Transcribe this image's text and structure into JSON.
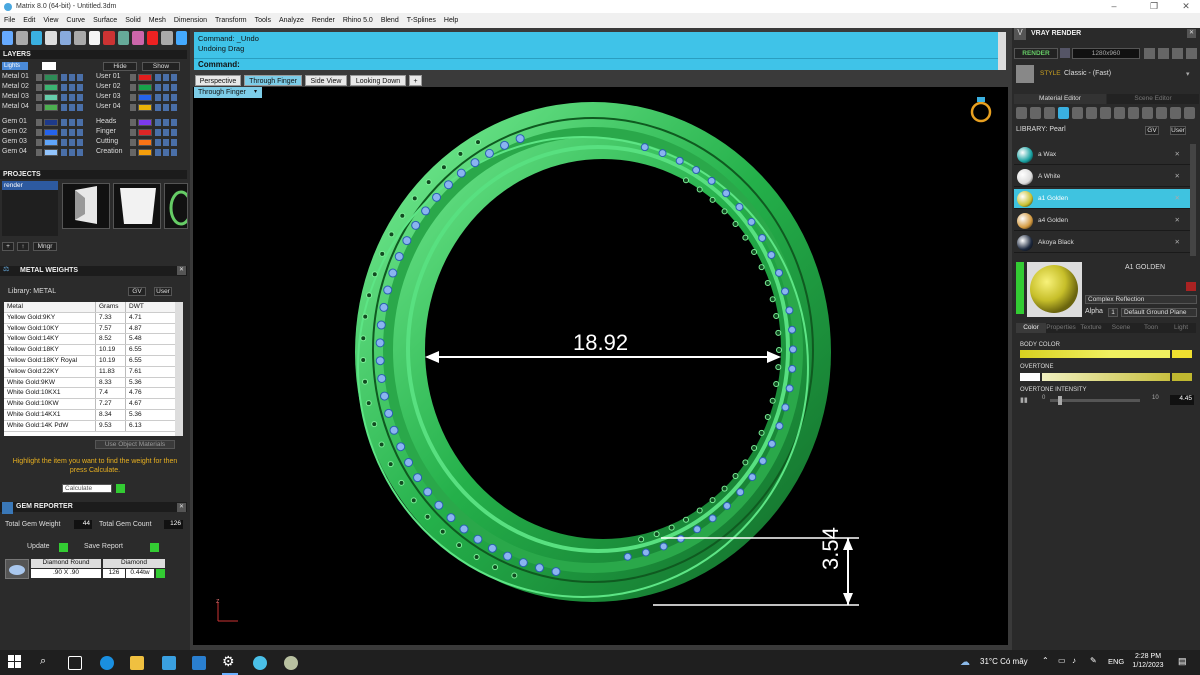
{
  "window": {
    "title": "Matrix 8.0 (64-bit) - Untitled.3dm"
  },
  "menu": [
    "File",
    "Edit",
    "View",
    "Curve",
    "Surface",
    "Solid",
    "Mesh",
    "Dimension",
    "Transform",
    "Tools",
    "Analyze",
    "Render",
    "Rhino 5.0",
    "Blend",
    "T-Splines",
    "Help"
  ],
  "layers": {
    "title": "LAYERS",
    "lights_label": "Lights",
    "hide_label": "Hide",
    "show_label": "Show",
    "left": [
      {
        "name": "Metal 01",
        "color": "#2e8b57"
      },
      {
        "name": "Metal 02",
        "color": "#3cb371"
      },
      {
        "name": "Metal 03",
        "color": "#66cdaa"
      },
      {
        "name": "Metal 04",
        "color": "#4caf50"
      },
      {
        "name": "Gem 01",
        "color": "#1e3a8a"
      },
      {
        "name": "Gem 02",
        "color": "#2563eb"
      },
      {
        "name": "Gem 03",
        "color": "#60a5fa"
      },
      {
        "name": "Gem 04",
        "color": "#93c5fd"
      }
    ],
    "right": [
      {
        "name": "User 01",
        "color": "#e11d1d"
      },
      {
        "name": "User 02",
        "color": "#16a34a"
      },
      {
        "name": "User 03",
        "color": "#2563eb"
      },
      {
        "name": "User 04",
        "color": "#eab308"
      },
      {
        "name": "Heads",
        "color": "#7c3aed"
      },
      {
        "name": "Finger",
        "color": "#dc2626"
      },
      {
        "name": "Cutting",
        "color": "#f97316"
      },
      {
        "name": "Creation",
        "color": "#f59e0b"
      }
    ]
  },
  "projects": {
    "title": "PROJECTS",
    "item": "render",
    "thumbs": [
      "1",
      "2",
      "3"
    ],
    "mngr_label": "Mngr"
  },
  "metal_weights": {
    "title": "METAL WEIGHTS",
    "library_label": "Library: METAL",
    "gv": "GV",
    "user": "User",
    "headers": [
      "Metal",
      "Grams",
      "DWT"
    ],
    "rows": [
      [
        "Yellow Gold:9KY",
        "7.33",
        "4.71"
      ],
      [
        "Yellow Gold:10KY",
        "7.57",
        "4.87"
      ],
      [
        "Yellow Gold:14KY",
        "8.52",
        "5.48"
      ],
      [
        "Yellow Gold:18KY",
        "10.19",
        "6.55"
      ],
      [
        "Yellow Gold:18KY Royal",
        "10.19",
        "6.55"
      ],
      [
        "Yellow Gold:22KY",
        "11.83",
        "7.61"
      ],
      [
        "White Gold:9KW",
        "8.33",
        "5.36"
      ],
      [
        "White Gold:10KX1",
        "7.4",
        "4.76"
      ],
      [
        "White Gold:10KW",
        "7.27",
        "4.67"
      ],
      [
        "White Gold:14KX1",
        "8.34",
        "5.36"
      ],
      [
        "White Gold:14K PdW",
        "9.53",
        "6.13"
      ]
    ],
    "use_object_materials": "Use Object Materials",
    "hint": "Highlight the item you want to find the weight for then press Calculate.",
    "calculate_label": "Calculate"
  },
  "gem_reporter": {
    "title": "GEM REPORTER",
    "total_weight_label": "Total Gem Weight",
    "total_weight_value": "44",
    "total_count_label": "Total Gem Count",
    "total_count_value": "126",
    "update_label": "Update",
    "save_report_label": "Save Report",
    "gem_name": "Diamond Round",
    "gem_size": ".90 X .90",
    "gem_material": "Diamond",
    "gem_count": "126",
    "gem_weight": "0.44tw"
  },
  "command": {
    "line1": "Command: _Undo",
    "line2": "Undoing Drag",
    "prompt": "Command:"
  },
  "viewport_tabs": [
    "Perspective",
    "Through Finger",
    "Side View",
    "Looking Down"
  ],
  "active_viewport": "Through Finger",
  "viewport": {
    "diameter_label": "18.92",
    "height_label": "3.54",
    "axis_label": "z"
  },
  "vray": {
    "title": "VRAY RENDER",
    "render_label": "RENDER",
    "resolution": "1280x960",
    "style_label": "STYLE",
    "style_value": "Classic - (Fast)",
    "tabs": [
      "Material Editor",
      "Scene Editor"
    ],
    "library_label": "LIBRARY: Pearl",
    "gv": "GV",
    "user": "User",
    "materials": [
      {
        "name": "a Wax",
        "color": "#1aa3a3"
      },
      {
        "name": "A White",
        "color": "#dcdcdc"
      },
      {
        "name": "a1 Golden",
        "color": "#c8c030"
      },
      {
        "name": "a4 Golden",
        "color": "#d49a40"
      },
      {
        "name": "Akoya Black",
        "color": "#1e2a40"
      }
    ],
    "selected_material": "A1 GOLDEN",
    "reflection": "Complex Reflection",
    "alpha_label": "Alpha",
    "ground_plane": "Default Ground Plane",
    "sub_tabs": [
      "Color",
      "Properties",
      "Texture",
      "Scene",
      "Toon",
      "Light"
    ],
    "body_color_label": "BODY COLOR",
    "overtone_label": "OVERTONE",
    "overtone_intensity_label": "OVERTONE INTENSITY",
    "intensity_min": "0",
    "intensity_max": "10",
    "intensity_value": "4.45"
  },
  "taskbar": {
    "weather": "31°C Có mây",
    "lang": "ENG",
    "time": "2:28 PM",
    "date": "1/12/2023"
  }
}
